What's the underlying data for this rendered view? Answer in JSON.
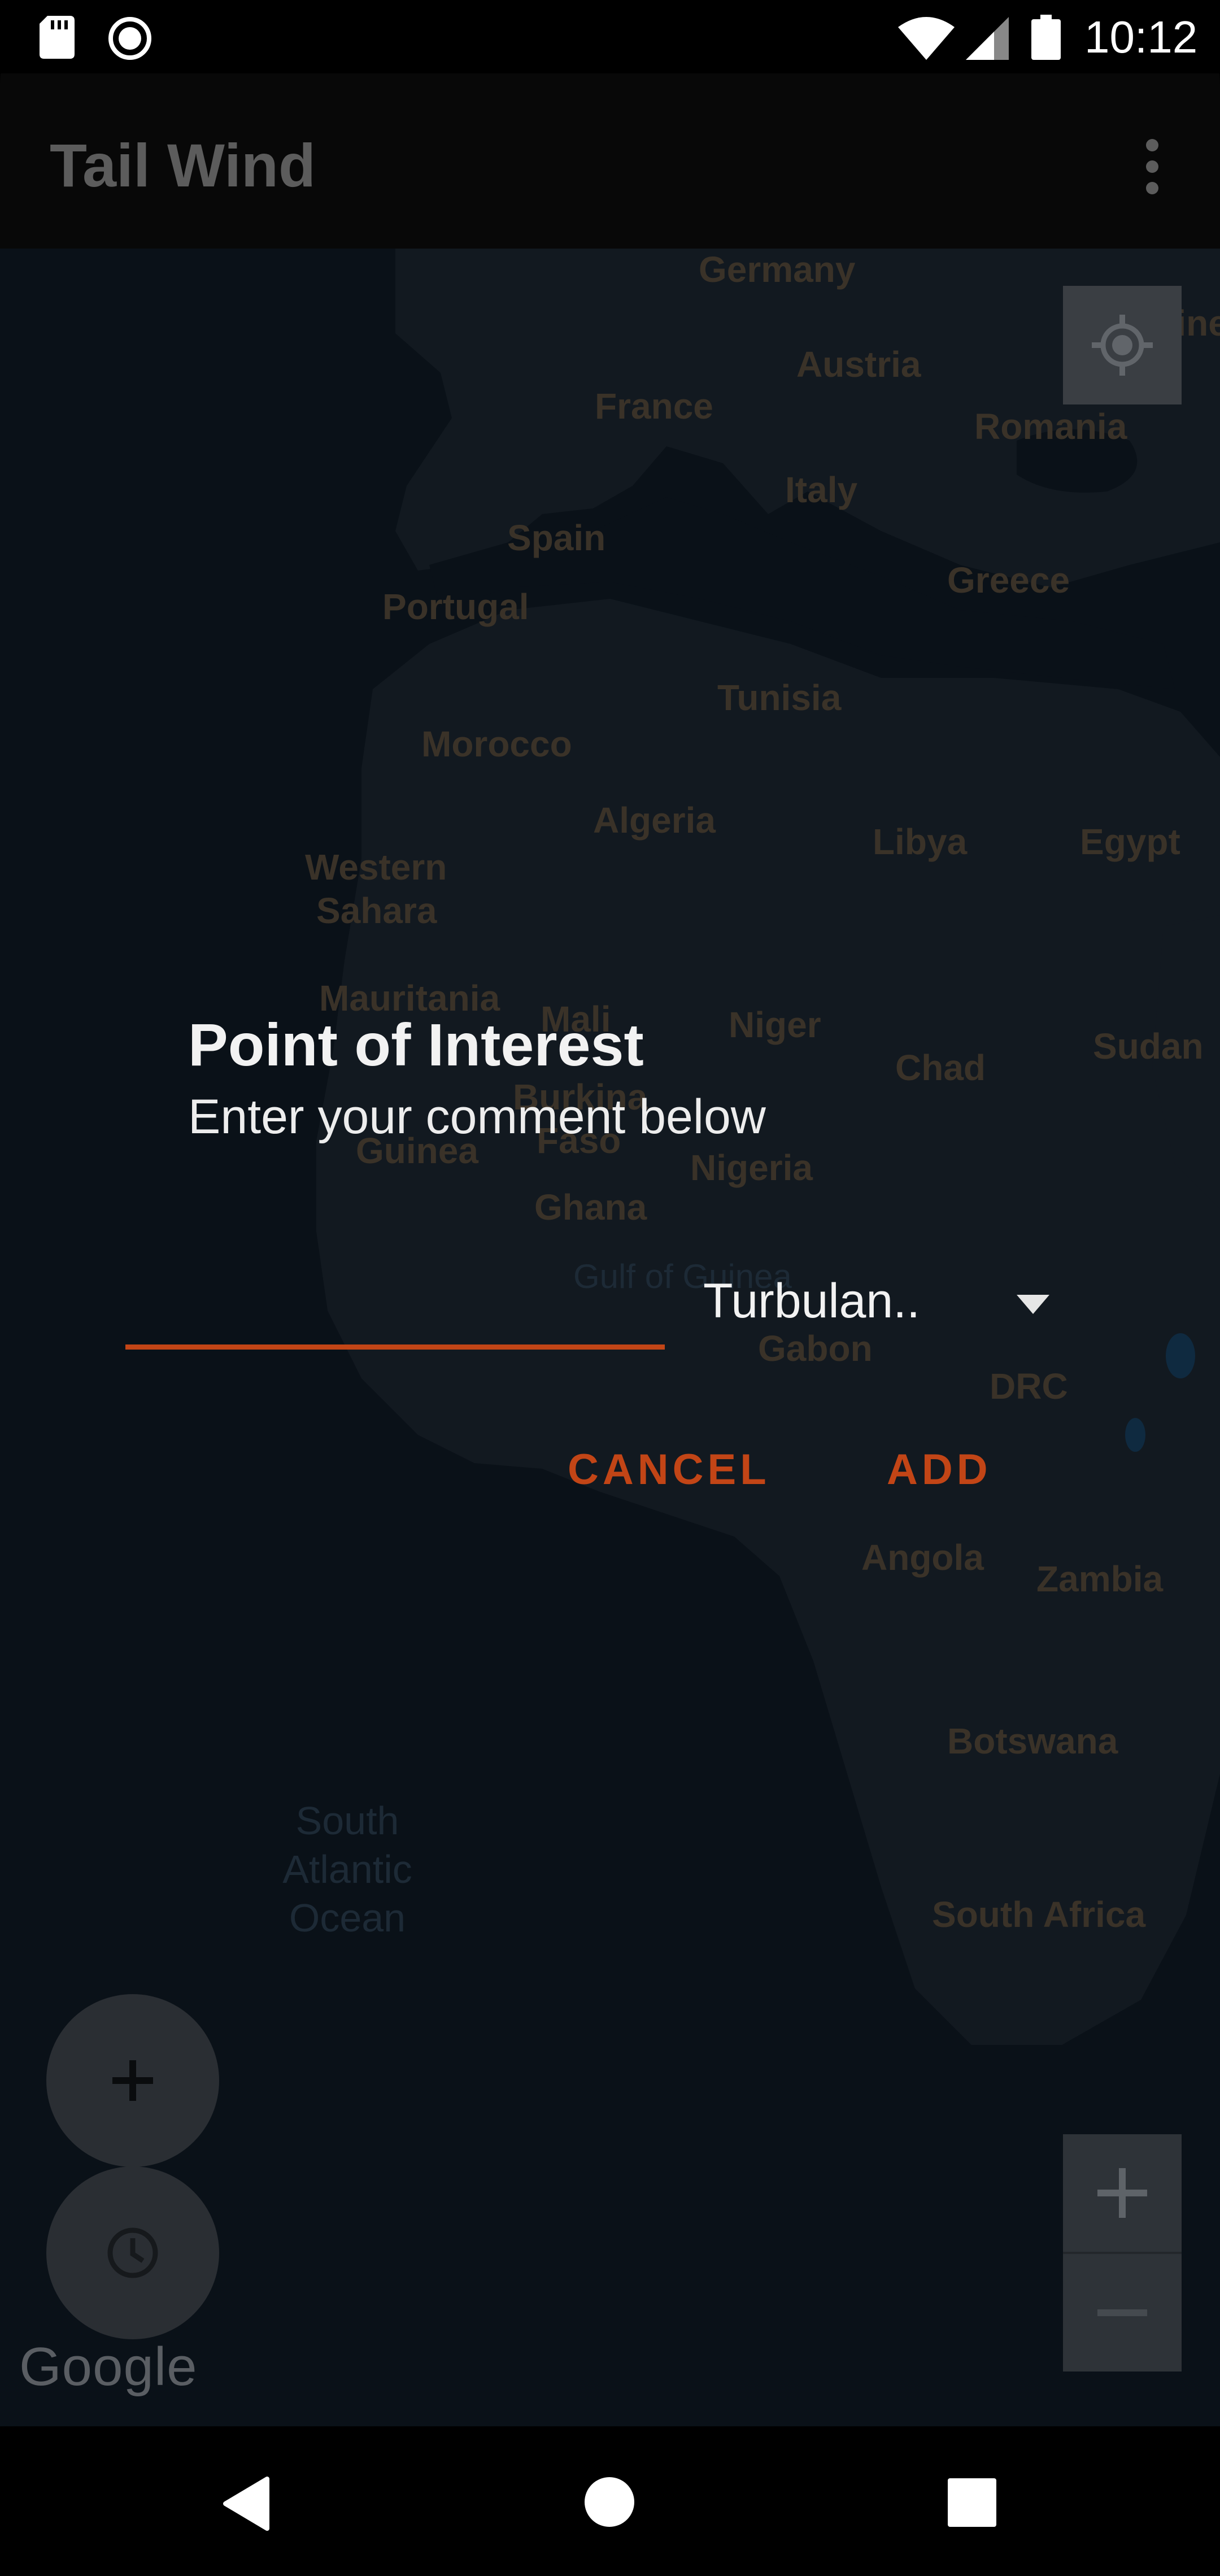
{
  "status_bar": {
    "time": "10:12"
  },
  "app_bar": {
    "title": "Tail Wind"
  },
  "map": {
    "labels": {
      "germany": "Germany",
      "austria": "Austria",
      "ukraine": "Ukraine",
      "france": "France",
      "romania": "Romania",
      "italy": "Italy",
      "spain": "Spain",
      "portugal": "Portugal",
      "greece": "Greece",
      "tunisia": "Tunisia",
      "morocco": "Morocco",
      "algeria": "Algeria",
      "libya": "Libya",
      "egypt": "Egypt",
      "western_sahara_1": "Western",
      "western_sahara_2": "Sahara",
      "mauritania": "Mauritania",
      "mali": "Mali",
      "niger": "Niger",
      "sudan": "Sudan",
      "chad": "Chad",
      "burkina_1": "Burkina",
      "burkina_2": "Faso",
      "guinea": "Guinea",
      "nigeria": "Nigeria",
      "ghana": "Ghana",
      "gulf_of_guinea": "Gulf of Guinea",
      "gabon": "Gabon",
      "drc": "DRC",
      "angola": "Angola",
      "zambia": "Zambia",
      "botswana": "Botswana",
      "south_atlantic_1": "South",
      "south_atlantic_2": "Atlantic",
      "south_atlantic_3": "Ocean",
      "south_africa": "South Africa"
    },
    "attribution": "Google"
  },
  "dialog": {
    "title": "Point of Interest",
    "message": "Enter your comment below",
    "comment_value": "",
    "category_selected": "Turbulan..",
    "cancel_label": "CANCEL",
    "add_label": "ADD",
    "accent_color": "#c24516"
  },
  "icons": {
    "status_left": [
      "sd-card-icon",
      "record-icon"
    ],
    "status_right": [
      "wifi-icon",
      "cell-signal-icon",
      "battery-icon"
    ],
    "app_bar": "overflow-menu-icon",
    "map_controls": [
      "my-location-icon",
      "zoom-in-icon",
      "zoom-out-icon",
      "add-icon",
      "history-icon"
    ],
    "nav": [
      "back-icon",
      "home-icon",
      "recents-icon"
    ]
  }
}
